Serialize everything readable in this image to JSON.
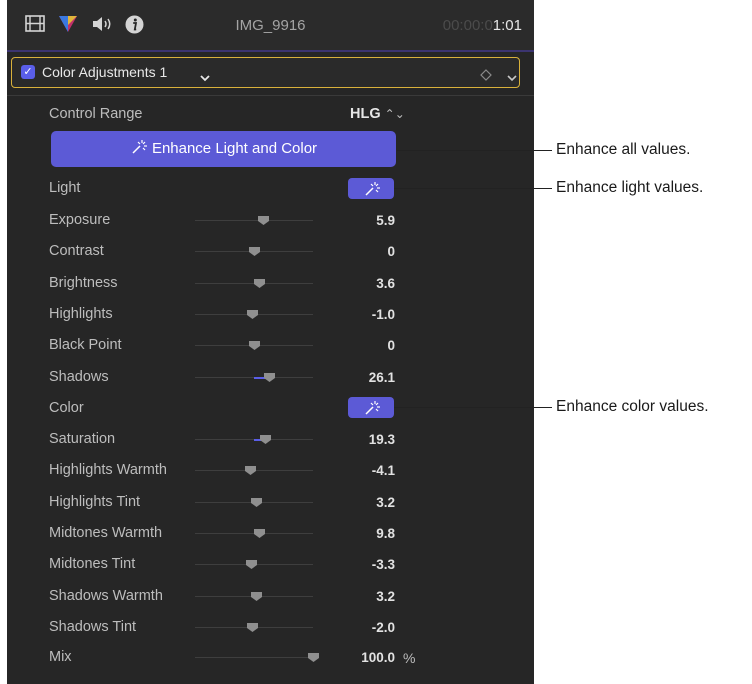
{
  "header": {
    "clip_name": "IMG_9916",
    "timecode_dim": "00:00:0",
    "timecode_bright": "1:01"
  },
  "effect": {
    "title": "Color Adjustments 1",
    "enabled": true
  },
  "control_range": {
    "label": "Control Range",
    "value": "HLG"
  },
  "enhance_all_label": "Enhance Light and Color",
  "sections": {
    "light": "Light",
    "color": "Color"
  },
  "light_rows": [
    {
      "label": "Exposure",
      "value": "5.9",
      "level": 0.58,
      "fill_from": null
    },
    {
      "label": "Contrast",
      "value": "0",
      "level": 0.5,
      "fill_from": null
    },
    {
      "label": "Brightness",
      "value": "3.6",
      "level": 0.55,
      "fill_from": null
    },
    {
      "label": "Highlights",
      "value": "-1.0",
      "level": 0.49,
      "fill_from": null
    },
    {
      "label": "Black Point",
      "value": "0",
      "level": 0.5,
      "fill_from": null
    },
    {
      "label": "Shadows",
      "value": "26.1",
      "level": 0.63,
      "fill_from": 0.5
    }
  ],
  "color_rows": [
    {
      "label": "Saturation",
      "value": "19.3",
      "level": 0.6,
      "fill_from": 0.5
    },
    {
      "label": "Highlights Warmth",
      "value": "-4.1",
      "level": 0.47,
      "fill_from": null
    },
    {
      "label": "Highlights Tint",
      "value": "3.2",
      "level": 0.52,
      "fill_from": null
    },
    {
      "label": "Midtones Warmth",
      "value": "9.8",
      "level": 0.55,
      "fill_from": null
    },
    {
      "label": "Midtones Tint",
      "value": "-3.3",
      "level": 0.48,
      "fill_from": null
    },
    {
      "label": "Shadows Warmth",
      "value": "3.2",
      "level": 0.52,
      "fill_from": null
    },
    {
      "label": "Shadows Tint",
      "value": "-2.0",
      "level": 0.49,
      "fill_from": null
    }
  ],
  "mix": {
    "label": "Mix",
    "value": "100.0",
    "unit": "%",
    "level": 1.0
  },
  "callouts": {
    "enhance_all": "Enhance all values.",
    "enhance_light": "Enhance light values.",
    "enhance_color": "Enhance color values."
  },
  "colors": {
    "accent": "#5c5ad6",
    "panel_bg": "#262626",
    "selection_outline": "#d9b13b"
  }
}
